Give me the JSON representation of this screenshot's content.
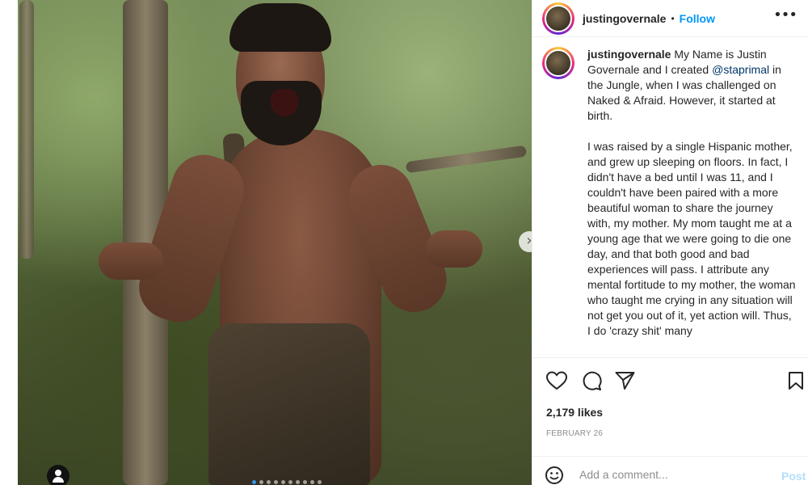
{
  "post": {
    "image_alt": "tattooed man in jungle",
    "carousel": {
      "total_slides": 10,
      "active_index": 0
    },
    "icons": {
      "next": "chevron-right-icon",
      "tagged_users": "user-tag-icon"
    }
  },
  "header": {
    "username": "justingovernale",
    "separator": "•",
    "follow_label": "Follow",
    "more_icon": "more-options-icon"
  },
  "caption": {
    "username": "justingovernale",
    "intro_before_mention": "My Name is Justin Governale and I created",
    "mention": "@staprimal",
    "intro_after_mention": "in the Jungle, when I was challenged on Naked & Afraid. However, it started at birth.",
    "paragraph2": "I was raised by a single Hispanic mother, and grew up sleeping on floors. In fact, I didn't have a bed until I was 11, and I couldn't have been paired with a more beautiful woman to share the journey with, my mother. My mom taught me at a young age that we were going to die one day, and that both good and bad experiences will pass. I attribute any mental fortitude to my mother, the woman who taught me crying in any situation will not get you out of it, yet action will. Thus, I do 'crazy shit' many"
  },
  "actions": {
    "like_icon": "heart-icon",
    "comment_icon": "comment-icon",
    "share_icon": "share-icon",
    "save_icon": "bookmark-icon"
  },
  "likes_text": "2,179 likes",
  "date_text": "FEBRUARY 26",
  "comment": {
    "placeholder": "Add a comment...",
    "post_label": "Post",
    "emoji_icon": "emoji-icon"
  },
  "colors": {
    "link_blue": "#0095f6",
    "mention_blue": "#00376b",
    "border": "#efefef",
    "muted": "#8e8e8e"
  }
}
